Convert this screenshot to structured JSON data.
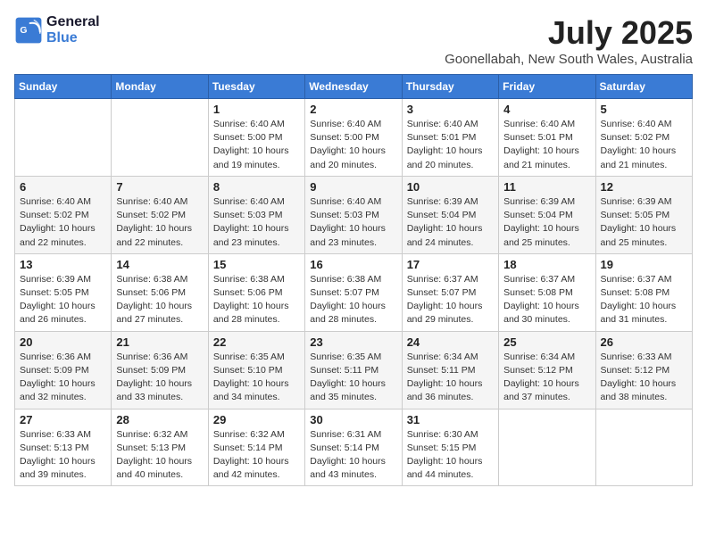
{
  "logo": {
    "line1": "General",
    "line2": "Blue"
  },
  "title": {
    "month_year": "July 2025",
    "location": "Goonellabah, New South Wales, Australia"
  },
  "days_of_week": [
    "Sunday",
    "Monday",
    "Tuesday",
    "Wednesday",
    "Thursday",
    "Friday",
    "Saturday"
  ],
  "weeks": [
    [
      {
        "day": "",
        "sunrise": "",
        "sunset": "",
        "daylight": ""
      },
      {
        "day": "",
        "sunrise": "",
        "sunset": "",
        "daylight": ""
      },
      {
        "day": "1",
        "sunrise": "Sunrise: 6:40 AM",
        "sunset": "Sunset: 5:00 PM",
        "daylight": "Daylight: 10 hours and 19 minutes."
      },
      {
        "day": "2",
        "sunrise": "Sunrise: 6:40 AM",
        "sunset": "Sunset: 5:00 PM",
        "daylight": "Daylight: 10 hours and 20 minutes."
      },
      {
        "day": "3",
        "sunrise": "Sunrise: 6:40 AM",
        "sunset": "Sunset: 5:01 PM",
        "daylight": "Daylight: 10 hours and 20 minutes."
      },
      {
        "day": "4",
        "sunrise": "Sunrise: 6:40 AM",
        "sunset": "Sunset: 5:01 PM",
        "daylight": "Daylight: 10 hours and 21 minutes."
      },
      {
        "day": "5",
        "sunrise": "Sunrise: 6:40 AM",
        "sunset": "Sunset: 5:02 PM",
        "daylight": "Daylight: 10 hours and 21 minutes."
      }
    ],
    [
      {
        "day": "6",
        "sunrise": "Sunrise: 6:40 AM",
        "sunset": "Sunset: 5:02 PM",
        "daylight": "Daylight: 10 hours and 22 minutes."
      },
      {
        "day": "7",
        "sunrise": "Sunrise: 6:40 AM",
        "sunset": "Sunset: 5:02 PM",
        "daylight": "Daylight: 10 hours and 22 minutes."
      },
      {
        "day": "8",
        "sunrise": "Sunrise: 6:40 AM",
        "sunset": "Sunset: 5:03 PM",
        "daylight": "Daylight: 10 hours and 23 minutes."
      },
      {
        "day": "9",
        "sunrise": "Sunrise: 6:40 AM",
        "sunset": "Sunset: 5:03 PM",
        "daylight": "Daylight: 10 hours and 23 minutes."
      },
      {
        "day": "10",
        "sunrise": "Sunrise: 6:39 AM",
        "sunset": "Sunset: 5:04 PM",
        "daylight": "Daylight: 10 hours and 24 minutes."
      },
      {
        "day": "11",
        "sunrise": "Sunrise: 6:39 AM",
        "sunset": "Sunset: 5:04 PM",
        "daylight": "Daylight: 10 hours and 25 minutes."
      },
      {
        "day": "12",
        "sunrise": "Sunrise: 6:39 AM",
        "sunset": "Sunset: 5:05 PM",
        "daylight": "Daylight: 10 hours and 25 minutes."
      }
    ],
    [
      {
        "day": "13",
        "sunrise": "Sunrise: 6:39 AM",
        "sunset": "Sunset: 5:05 PM",
        "daylight": "Daylight: 10 hours and 26 minutes."
      },
      {
        "day": "14",
        "sunrise": "Sunrise: 6:38 AM",
        "sunset": "Sunset: 5:06 PM",
        "daylight": "Daylight: 10 hours and 27 minutes."
      },
      {
        "day": "15",
        "sunrise": "Sunrise: 6:38 AM",
        "sunset": "Sunset: 5:06 PM",
        "daylight": "Daylight: 10 hours and 28 minutes."
      },
      {
        "day": "16",
        "sunrise": "Sunrise: 6:38 AM",
        "sunset": "Sunset: 5:07 PM",
        "daylight": "Daylight: 10 hours and 28 minutes."
      },
      {
        "day": "17",
        "sunrise": "Sunrise: 6:37 AM",
        "sunset": "Sunset: 5:07 PM",
        "daylight": "Daylight: 10 hours and 29 minutes."
      },
      {
        "day": "18",
        "sunrise": "Sunrise: 6:37 AM",
        "sunset": "Sunset: 5:08 PM",
        "daylight": "Daylight: 10 hours and 30 minutes."
      },
      {
        "day": "19",
        "sunrise": "Sunrise: 6:37 AM",
        "sunset": "Sunset: 5:08 PM",
        "daylight": "Daylight: 10 hours and 31 minutes."
      }
    ],
    [
      {
        "day": "20",
        "sunrise": "Sunrise: 6:36 AM",
        "sunset": "Sunset: 5:09 PM",
        "daylight": "Daylight: 10 hours and 32 minutes."
      },
      {
        "day": "21",
        "sunrise": "Sunrise: 6:36 AM",
        "sunset": "Sunset: 5:09 PM",
        "daylight": "Daylight: 10 hours and 33 minutes."
      },
      {
        "day": "22",
        "sunrise": "Sunrise: 6:35 AM",
        "sunset": "Sunset: 5:10 PM",
        "daylight": "Daylight: 10 hours and 34 minutes."
      },
      {
        "day": "23",
        "sunrise": "Sunrise: 6:35 AM",
        "sunset": "Sunset: 5:11 PM",
        "daylight": "Daylight: 10 hours and 35 minutes."
      },
      {
        "day": "24",
        "sunrise": "Sunrise: 6:34 AM",
        "sunset": "Sunset: 5:11 PM",
        "daylight": "Daylight: 10 hours and 36 minutes."
      },
      {
        "day": "25",
        "sunrise": "Sunrise: 6:34 AM",
        "sunset": "Sunset: 5:12 PM",
        "daylight": "Daylight: 10 hours and 37 minutes."
      },
      {
        "day": "26",
        "sunrise": "Sunrise: 6:33 AM",
        "sunset": "Sunset: 5:12 PM",
        "daylight": "Daylight: 10 hours and 38 minutes."
      }
    ],
    [
      {
        "day": "27",
        "sunrise": "Sunrise: 6:33 AM",
        "sunset": "Sunset: 5:13 PM",
        "daylight": "Daylight: 10 hours and 39 minutes."
      },
      {
        "day": "28",
        "sunrise": "Sunrise: 6:32 AM",
        "sunset": "Sunset: 5:13 PM",
        "daylight": "Daylight: 10 hours and 40 minutes."
      },
      {
        "day": "29",
        "sunrise": "Sunrise: 6:32 AM",
        "sunset": "Sunset: 5:14 PM",
        "daylight": "Daylight: 10 hours and 42 minutes."
      },
      {
        "day": "30",
        "sunrise": "Sunrise: 6:31 AM",
        "sunset": "Sunset: 5:14 PM",
        "daylight": "Daylight: 10 hours and 43 minutes."
      },
      {
        "day": "31",
        "sunrise": "Sunrise: 6:30 AM",
        "sunset": "Sunset: 5:15 PM",
        "daylight": "Daylight: 10 hours and 44 minutes."
      },
      {
        "day": "",
        "sunrise": "",
        "sunset": "",
        "daylight": ""
      },
      {
        "day": "",
        "sunrise": "",
        "sunset": "",
        "daylight": ""
      }
    ]
  ]
}
